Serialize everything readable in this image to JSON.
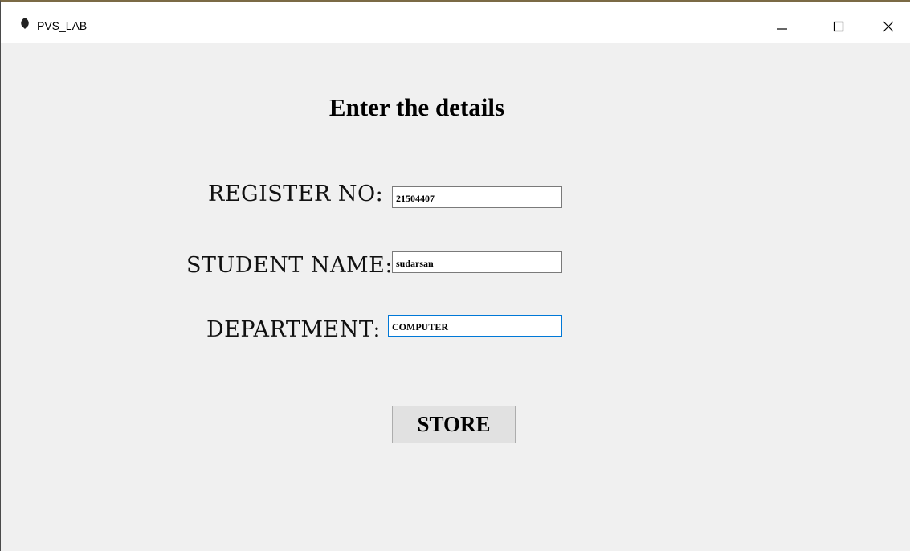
{
  "window": {
    "title": "PVS_LAB"
  },
  "form": {
    "heading": "Enter the details",
    "register_no_label": "REGISTER NO:",
    "register_no_value": "21504407",
    "student_name_label": "STUDENT NAME:",
    "student_name_value": "sudarsan",
    "department_label": "DEPARTMENT:",
    "department_value": "COMPUTER",
    "store_button_label": "STORE"
  },
  "icons": {
    "app": "feather-app-icon",
    "minimize": "minimize-icon",
    "maximize": "maximize-icon",
    "close": "close-icon"
  },
  "colors": {
    "client_background": "#f0f0f0",
    "focus_border": "#0078d7",
    "button_background": "#e1e1e1"
  }
}
